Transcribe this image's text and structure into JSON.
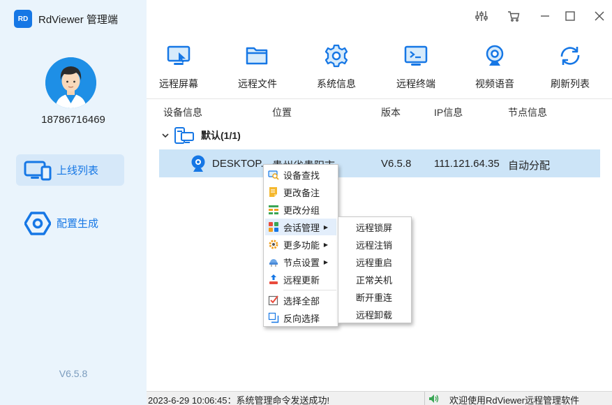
{
  "app": {
    "badge": "RD",
    "title": "RdViewer 管理端"
  },
  "user": {
    "phone": "18786716469"
  },
  "sidebar": {
    "items": [
      {
        "label": "上线列表",
        "icon": "monitor-icon",
        "active": true
      },
      {
        "label": "配置生成",
        "icon": "hexagon-icon",
        "active": false
      }
    ],
    "version": "V6.5.8"
  },
  "window_controls": [
    "settings-sliders-icon",
    "cart-icon",
    "minimize-icon",
    "maximize-icon",
    "close-icon"
  ],
  "toolbar": [
    {
      "label": "远程屏幕",
      "icon": "remote-screen-icon"
    },
    {
      "label": "远程文件",
      "icon": "folder-icon"
    },
    {
      "label": "系统信息",
      "icon": "gear-icon"
    },
    {
      "label": "远程终端",
      "icon": "terminal-icon"
    },
    {
      "label": "视频语音",
      "icon": "webcam-icon"
    },
    {
      "label": "刷新列表",
      "icon": "refresh-icon"
    }
  ],
  "table": {
    "columns": [
      "设备信息",
      "位置",
      "版本",
      "IP信息",
      "节点信息"
    ],
    "group": {
      "label": "默认(1/1)"
    },
    "rows": [
      {
        "device": "DESKTOP...",
        "location": "贵州省贵阳市",
        "version": "V6.5.8",
        "ip": "111.121.64.35",
        "node": "自动分配"
      }
    ]
  },
  "context_menu": {
    "items": [
      {
        "label": "设备查找",
        "icon": "search-device-icon"
      },
      {
        "label": "更改备注",
        "icon": "note-icon"
      },
      {
        "label": "更改分组",
        "icon": "group-icon"
      },
      {
        "label": "会话管理",
        "icon": "session-icon",
        "submenu": true,
        "highlighted": true
      },
      {
        "label": "更多功能",
        "icon": "more-functions-icon",
        "submenu": true
      },
      {
        "label": "节点设置",
        "icon": "node-settings-icon",
        "submenu": true
      },
      {
        "label": "远程更新",
        "icon": "remote-update-icon"
      },
      {
        "label": "选择全部",
        "icon": "select-all-icon"
      },
      {
        "label": "反向选择",
        "icon": "invert-selection-icon"
      }
    ]
  },
  "submenu": {
    "items": [
      "远程锁屏",
      "远程注销",
      "远程重启",
      "正常关机",
      "断开重连",
      "远程卸载"
    ]
  },
  "status": {
    "left": "2023-6-29 10:06:45：系统管理命令发送成功!",
    "right": "欢迎使用RdViewer远程管理软件",
    "speaker_icon": "speaker-icon"
  },
  "colors": {
    "accent": "#1677e5",
    "sidebar_bg": "#eaf4fc",
    "selected_row": "#cce4f7"
  }
}
